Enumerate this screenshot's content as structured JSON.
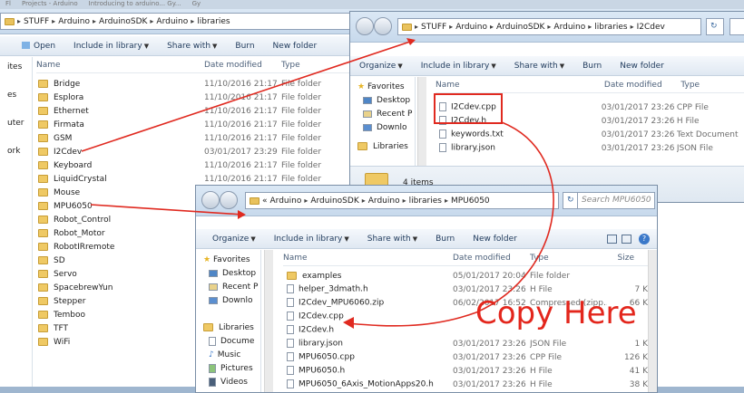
{
  "colors": {
    "accent": "#e02a20",
    "folder": "#efc964",
    "toolbar_text": "#1e395b"
  },
  "bg": {
    "tabs": [
      "Fl",
      "Projects - Arduino",
      "Introducing to arduino... Gy...",
      "Gy"
    ],
    "path": [
      "STUFF",
      "Arduino",
      "ArduinoSDK",
      "Arduino",
      "libraries"
    ],
    "toolbar": [
      "Open",
      "Include in library",
      "Share with",
      "Burn",
      "New folder"
    ],
    "nav": [
      "ites",
      "es",
      "uter",
      "ork"
    ],
    "headers": {
      "name": "Name",
      "date": "Date modified",
      "type": "Type"
    },
    "rows": [
      {
        "name": "Bridge",
        "date": "11/10/2016 21:17",
        "type": "File folder"
      },
      {
        "name": "Esplora",
        "date": "11/10/2016 21:17",
        "type": "File folder"
      },
      {
        "name": "Ethernet",
        "date": "11/10/2016 21:17",
        "type": "File folder"
      },
      {
        "name": "Firmata",
        "date": "11/10/2016 21:17",
        "type": "File folder"
      },
      {
        "name": "GSM",
        "date": "11/10/2016 21:17",
        "type": "File folder"
      },
      {
        "name": "I2Cdev",
        "date": "03/01/2017 23:29",
        "type": "File folder"
      },
      {
        "name": "Keyboard",
        "date": "11/10/2016 21:17",
        "type": "File folder"
      },
      {
        "name": "LiquidCrystal",
        "date": "11/10/2016 21:17",
        "type": "File folder"
      },
      {
        "name": "Mouse",
        "date": "11/10/2016 21:17",
        "type": "File folder"
      },
      {
        "name": "MPU6050",
        "date": "",
        "type": ""
      },
      {
        "name": "Robot_Control",
        "date": "",
        "type": ""
      },
      {
        "name": "Robot_Motor",
        "date": "",
        "type": ""
      },
      {
        "name": "RobotIRremote",
        "date": "",
        "type": ""
      },
      {
        "name": "SD",
        "date": "",
        "type": ""
      },
      {
        "name": "Servo",
        "date": "",
        "type": ""
      },
      {
        "name": "SpacebrewYun",
        "date": "",
        "type": ""
      },
      {
        "name": "Stepper",
        "date": "",
        "type": ""
      },
      {
        "name": "Temboo",
        "date": "",
        "type": ""
      },
      {
        "name": "TFT",
        "date": "",
        "type": ""
      },
      {
        "name": "WiFi",
        "date": "",
        "type": ""
      }
    ]
  },
  "w1": {
    "path": [
      "STUFF",
      "Arduino",
      "ArduinoSDK",
      "Arduino",
      "libraries",
      "I2Cdev"
    ],
    "toolbar": [
      "Organize",
      "Include in library",
      "Share with",
      "Burn",
      "New folder"
    ],
    "nav": [
      "Favorites",
      "Desktop",
      "Recent P",
      "Downlo",
      "Libraries"
    ],
    "headers": {
      "name": "Name",
      "date": "Date modified",
      "type": "Type"
    },
    "rows": [
      {
        "name": "I2Cdev.cpp",
        "date": "03/01/2017 23:26",
        "type": "CPP File"
      },
      {
        "name": "I2Cdev.h",
        "date": "03/01/2017 23:26",
        "type": "H File"
      },
      {
        "name": "keywords.txt",
        "date": "03/01/2017 23:26",
        "type": "Text Document"
      },
      {
        "name": "library.json",
        "date": "03/01/2017 23:26",
        "type": "JSON File"
      }
    ],
    "status": "4 items"
  },
  "w2": {
    "path": [
      "«",
      "Arduino",
      "ArduinoSDK",
      "Arduino",
      "libraries",
      "MPU6050"
    ],
    "search_placeholder": "Search MPU6050",
    "toolbar": [
      "Organize",
      "Include in library",
      "Share with",
      "Burn",
      "New folder"
    ],
    "nav": [
      "Favorites",
      "Desktop",
      "Recent P",
      "Downlo",
      "Libraries",
      "Docume",
      "Music",
      "Pictures",
      "Videos"
    ],
    "headers": {
      "name": "Name",
      "date": "Date modified",
      "type": "Type",
      "size": "Size"
    },
    "rows": [
      {
        "name": "examples",
        "date": "05/01/2017 20:04",
        "type": "File folder",
        "size": "",
        "folder": true
      },
      {
        "name": "helper_3dmath.h",
        "date": "03/01/2017 23:26",
        "type": "H File",
        "size": "7 K",
        "folder": false
      },
      {
        "name": "I2Cdev_MPU6060.zip",
        "date": "06/02/2017 16:52",
        "type": "Compressed (zipp...",
        "size": "66 K",
        "folder": false
      },
      {
        "name": "I2Cdev.cpp",
        "date": "",
        "type": "",
        "size": "",
        "folder": false
      },
      {
        "name": "I2Cdev.h",
        "date": "",
        "type": "",
        "size": "",
        "folder": false
      },
      {
        "name": "library.json",
        "date": "03/01/2017 23:26",
        "type": "JSON File",
        "size": "1 K",
        "folder": false
      },
      {
        "name": "MPU6050.cpp",
        "date": "03/01/2017 23:26",
        "type": "CPP File",
        "size": "126 K",
        "folder": false
      },
      {
        "name": "MPU6050.h",
        "date": "03/01/2017 23:26",
        "type": "H File",
        "size": "41 K",
        "folder": false
      },
      {
        "name": "MPU6050_6Axis_MotionApps20.h",
        "date": "03/01/2017 23:26",
        "type": "H File",
        "size": "38 K",
        "folder": false
      }
    ]
  },
  "annotation": "Copy Here"
}
